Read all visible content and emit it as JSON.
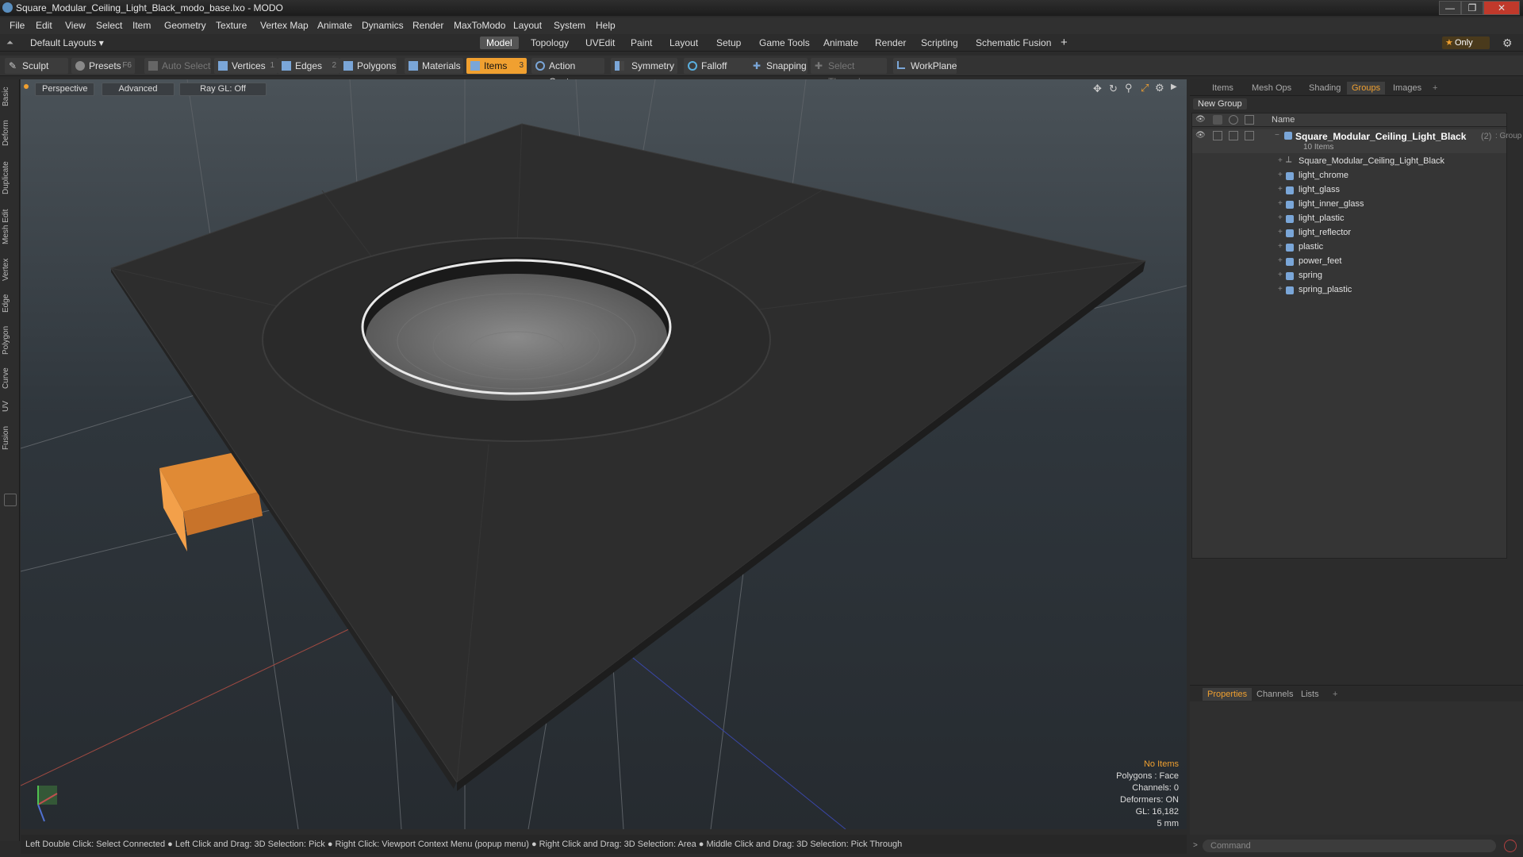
{
  "window": {
    "title": "Square_Modular_Ceiling_Light_Black_modo_base.lxo - MODO",
    "buttons": [
      "—",
      "❐",
      "✕"
    ]
  },
  "menu": [
    "File",
    "Edit",
    "View",
    "Select",
    "Item",
    "Geometry",
    "Texture",
    "Vertex Map",
    "Animate",
    "Dynamics",
    "Render",
    "MaxToModo",
    "Layout",
    "System",
    "Help"
  ],
  "layouts": {
    "current": "Default Layouts",
    "tabs": [
      "Model",
      "Topology",
      "UVEdit",
      "Paint",
      "Layout",
      "Setup",
      "Game Tools",
      "Animate",
      "Render",
      "Scripting",
      "Schematic Fusion"
    ],
    "active_tab": "Model",
    "add": "+",
    "only_label": "Only"
  },
  "toolbar": {
    "sculpt": "Sculpt",
    "presets": "Presets",
    "presets_key": "F6",
    "auto_select": "Auto Select",
    "vertices": "Vertices",
    "vertices_count": "1",
    "edges": "Edges",
    "edges_count": "2",
    "polygons": "Polygons",
    "materials": "Materials",
    "items": "Items",
    "items_count": "3",
    "action_center": "Action Center",
    "symmetry": "Symmetry",
    "falloff": "Falloff",
    "snapping": "Snapping",
    "select_through": "Select Through",
    "workplane": "WorkPlane"
  },
  "left_tabs": [
    "Basic",
    "Deform",
    "Duplicate",
    "Mesh Edit",
    "Vertex",
    "Edge",
    "Polygon",
    "Curve",
    "UV",
    "Fusion"
  ],
  "viewport": {
    "view": "Perspective",
    "shading": "Advanced",
    "raygl": "Ray GL: Off",
    "info": {
      "selection": "No Items",
      "polygons": "Polygons : Face",
      "channels": "Channels: 0",
      "deformers": "Deformers: ON",
      "gl": "GL: 16,182",
      "scale": "5 mm"
    }
  },
  "status": "Left Double Click: Select Connected ● Left Click and Drag: 3D Selection: Pick ● Right Click: Viewport Context Menu (popup menu) ● Right Click and Drag: 3D Selection: Area ● Middle Click and Drag: 3D Selection: Pick Through",
  "panel": {
    "tabs": [
      "Items",
      "Mesh Ops",
      "Shading",
      "Groups",
      "Images"
    ],
    "active_tab": "Groups",
    "new_group": "New Group",
    "column_name": "Name",
    "group": {
      "name": "Square_Modular_Ceiling_Light_Black",
      "count": "(2)",
      "type": ": Group",
      "subtitle": "10 Items"
    },
    "items": [
      "Square_Modular_Ceiling_Light_Black",
      "light_chrome",
      "light_glass",
      "light_inner_glass",
      "light_plastic",
      "light_reflector",
      "plastic",
      "power_feet",
      "spring",
      "spring_plastic"
    ],
    "bottom_tabs": [
      "Properties",
      "Channels",
      "Lists"
    ],
    "bottom_active": "Properties",
    "command_placeholder": "Command"
  },
  "colors": {
    "accent": "#f0a030",
    "item_icon": "#7aa6d8",
    "model_orange": "#f39a3a"
  }
}
